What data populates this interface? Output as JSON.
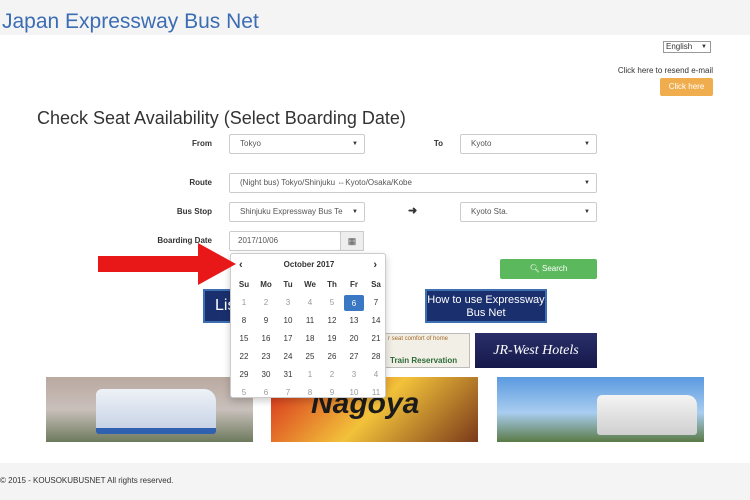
{
  "header": {
    "title": "Japan Expressway Bus Net"
  },
  "language": {
    "selected": "English"
  },
  "resend": {
    "text": "Click here to resend e-mail",
    "button": "Click here"
  },
  "form": {
    "heading": "Check Seat Availability (Select Boarding Date)",
    "from_label": "From",
    "from_value": "Tokyo",
    "to_label": "To",
    "to_value": "Kyoto",
    "route_label": "Route",
    "route_value": "(Night bus) Tokyo/Shinjuku ⇔Kyoto/Osaka/Kobe",
    "busstop_label": "Bus Stop",
    "busstop_from": "Shinjuku Expressway Bus Te",
    "busstop_to": "Kyoto Sta.",
    "date_label": "Boarding Date",
    "date_value": "2017/10/06",
    "search_button": "Search"
  },
  "calendar": {
    "month": "October 2017",
    "weekdays": [
      "Su",
      "Mo",
      "Tu",
      "We",
      "Th",
      "Fr",
      "Sa"
    ],
    "days": [
      {
        "d": "1",
        "off": true
      },
      {
        "d": "2",
        "off": true
      },
      {
        "d": "3",
        "off": true
      },
      {
        "d": "4",
        "off": true
      },
      {
        "d": "5",
        "off": true
      },
      {
        "d": "6",
        "active": true
      },
      {
        "d": "7"
      },
      {
        "d": "8"
      },
      {
        "d": "9"
      },
      {
        "d": "10"
      },
      {
        "d": "11"
      },
      {
        "d": "12"
      },
      {
        "d": "13"
      },
      {
        "d": "14"
      },
      {
        "d": "15"
      },
      {
        "d": "16"
      },
      {
        "d": "17"
      },
      {
        "d": "18"
      },
      {
        "d": "19"
      },
      {
        "d": "20"
      },
      {
        "d": "21"
      },
      {
        "d": "22"
      },
      {
        "d": "23"
      },
      {
        "d": "24"
      },
      {
        "d": "25"
      },
      {
        "d": "26"
      },
      {
        "d": "27"
      },
      {
        "d": "28"
      },
      {
        "d": "29"
      },
      {
        "d": "30"
      },
      {
        "d": "31"
      },
      {
        "d": "1",
        "off": true
      },
      {
        "d": "2",
        "off": true
      },
      {
        "d": "3",
        "off": true
      },
      {
        "d": "4",
        "off": true
      },
      {
        "d": "5",
        "off": true
      },
      {
        "d": "6",
        "off": true
      },
      {
        "d": "7",
        "off": true
      },
      {
        "d": "8",
        "off": true
      },
      {
        "d": "9",
        "off": true
      },
      {
        "d": "10",
        "off": true
      },
      {
        "d": "11",
        "off": true
      }
    ]
  },
  "banners": {
    "list": "Lis",
    "how_to_use": "How to use Expressway Bus Net",
    "train_top": "r seat comfort of home",
    "train": "Train Reservation",
    "jr_west": "JR-West Hotels",
    "nagoya": "Nagoya"
  },
  "footer": {
    "copyright": "© 2015 - KOUSOKUBUSNET All rights reserved."
  },
  "colors": {
    "title": "#3b6db3",
    "orange_button": "#f0ad4e",
    "search_button": "#5cb85c",
    "selected_day": "#3a78c3",
    "arrow": "#e81818"
  }
}
